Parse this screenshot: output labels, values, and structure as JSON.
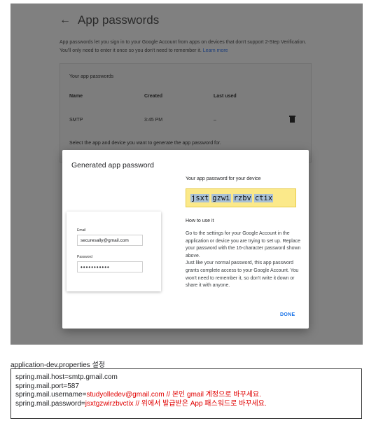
{
  "header": {
    "title": "App passwords",
    "back_icon": "arrow-left-icon"
  },
  "intro": {
    "text": "App passwords let you sign in to your Google Account from apps on devices that don't support 2-Step Verification. You'll only need to enter it once so you don't need to remember it.",
    "learn_more": "Learn more"
  },
  "card": {
    "heading": "Your app passwords",
    "columns": [
      "Name",
      "Created",
      "Last used"
    ],
    "rows": [
      {
        "name": "SMTP",
        "created": "3:45 PM",
        "last_used": "–"
      }
    ],
    "select_prompt": "Select the app and device you want to generate the app password for."
  },
  "dialog": {
    "title": "Generated app password",
    "illustration": {
      "email_label": "Email",
      "email_value": "securesally@gmail.com",
      "password_label": "Password",
      "password_value": "•••••••••••"
    },
    "password_label": "Your app password for your device",
    "password_chunks": [
      "jsxt",
      "gzwi",
      "rzbv",
      "ctix"
    ],
    "how_title": "How to use it",
    "instructions_1": "Go to the settings for your Google Account in the application or device you are trying to set up. Replace your password with the 16-character password shown above.",
    "instructions_2": "Just like your normal password, this app password grants complete access to your Google Account. You won't need to remember it, so don't write it down or share it with anyone.",
    "done_button": "DONE"
  },
  "caption": "application-dev.properties 설정",
  "code": {
    "line1": "spring.mail.host=smtp.gmail.com",
    "line2": "spring.mail.port=587",
    "line3_key": "spring.mail.username=",
    "line3_value": "studyolledev@gmail.com // 본인 gmail 계정으로 바꾸세요.",
    "line4_key": "spring.mail.password=",
    "line4_value": "jsxtgzwirzbvctix // 위에서 발급받은 App 패스워드로 바꾸세요."
  },
  "colors": {
    "accent": "#1a73e8",
    "highlight": "#fbe98a",
    "code_red": "#e00000",
    "overlay": "#808080"
  }
}
